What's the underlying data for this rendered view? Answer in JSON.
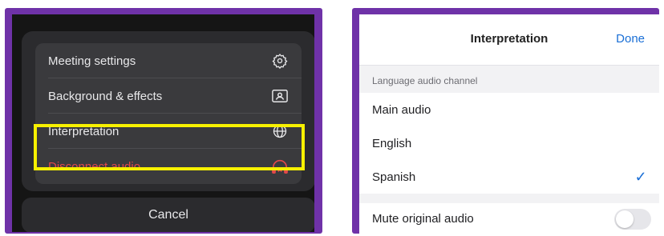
{
  "left_panel": {
    "menu_items": [
      {
        "label": "Meeting settings",
        "icon": "gear-icon"
      },
      {
        "label": "Background & effects",
        "icon": "portrait-frame-icon"
      },
      {
        "label": "Interpretation",
        "icon": "globe-icon"
      },
      {
        "label": "Disconnect audio",
        "icon": "headphones-off-icon"
      }
    ],
    "cancel_label": "Cancel",
    "highlight_color": "#f7f000",
    "danger_color": "#e2484a"
  },
  "right_panel": {
    "nav": {
      "title": "Interpretation",
      "done_label": "Done"
    },
    "section_header": "Language audio channel",
    "options": [
      {
        "label": "Main audio",
        "selected": false
      },
      {
        "label": "English",
        "selected": false
      },
      {
        "label": "Spanish",
        "selected": true
      }
    ],
    "check_glyph": "✓",
    "mute_label": "Mute original audio",
    "mute_enabled": false,
    "accent_color": "#1a6fd6"
  },
  "frame_color": "#6f32a8"
}
